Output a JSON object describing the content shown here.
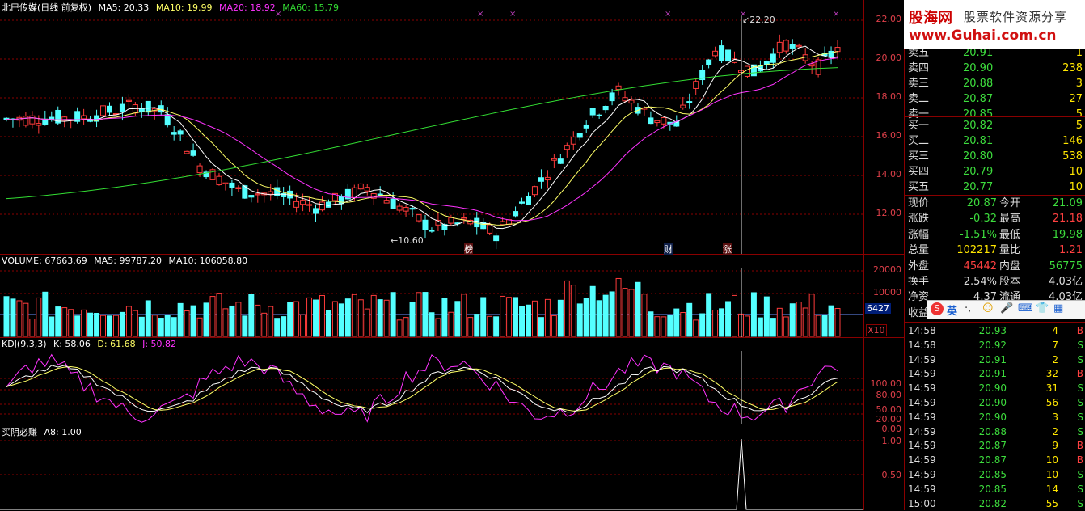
{
  "price_panel": {
    "title": "北巴传媒(日线 前复权)",
    "ma5": "MA5: 20.33",
    "ma10": "MA10: 19.99",
    "ma20": "MA20: 18.92",
    "ma60": "MA60: 15.79",
    "yticks": [
      "22.00",
      "20.00",
      "18.00",
      "16.00",
      "14.00",
      "12.00"
    ],
    "max_label": "22.20",
    "min_label": "10.60",
    "markers": [
      "榜",
      "财",
      "涨"
    ]
  },
  "volume_panel": {
    "volume": "VOLUME: 67663.69",
    "ma5": "MA5: 99787.20",
    "ma10": "MA10: 106058.80",
    "yticks": [
      "20000",
      "10000"
    ],
    "cursor_value": "6427",
    "unit": "X10"
  },
  "kdj_panel": {
    "name": "KDJ(9,3,3)",
    "k": "K: 58.06",
    "d": "D: 61.68",
    "j": "J: 50.82",
    "yticks": [
      "100.00",
      "80.00",
      "50.00",
      "20.00",
      "0.00"
    ]
  },
  "signal_panel": {
    "name": "买阴必赚",
    "a8": "A8: 1.00",
    "yticks": [
      "1.00",
      "0.50"
    ]
  },
  "banner": {
    "logo": "股海网",
    "slogan": "股票软件资源分享",
    "url": "www.Guhai.com.cn"
  },
  "order_book": {
    "asks": [
      {
        "label": "卖五",
        "price": "20.91",
        "vol": "1"
      },
      {
        "label": "卖四",
        "price": "20.90",
        "vol": "238"
      },
      {
        "label": "卖三",
        "price": "20.88",
        "vol": "3"
      },
      {
        "label": "卖二",
        "price": "20.87",
        "vol": "27"
      },
      {
        "label": "卖一",
        "price": "20.85",
        "vol": "5"
      }
    ],
    "bids": [
      {
        "label": "买一",
        "price": "20.82",
        "vol": "5"
      },
      {
        "label": "买二",
        "price": "20.81",
        "vol": "146"
      },
      {
        "label": "买三",
        "price": "20.80",
        "vol": "538"
      },
      {
        "label": "买四",
        "price": "20.79",
        "vol": "10"
      },
      {
        "label": "买五",
        "price": "20.77",
        "vol": "10"
      }
    ]
  },
  "quote": [
    {
      "l1": "现价",
      "v1": "20.87",
      "l2": "今开",
      "v2": "21.09"
    },
    {
      "l1": "涨跌",
      "v1": "-0.32",
      "l2": "最高",
      "v2": "21.18"
    },
    {
      "l1": "涨幅",
      "v1": "-1.51%",
      "l2": "最低",
      "v2": "19.98"
    },
    {
      "l1": "总量",
      "v1": "102217",
      "l2": "量比",
      "v2": "1.21"
    },
    {
      "l1": "外盘",
      "v1": "45442",
      "l2": "内盘",
      "v2": "56775"
    },
    {
      "l1": "换手",
      "v1": "2.54%",
      "l2": "股本",
      "v2": "4.03亿"
    },
    {
      "l1": "净资",
      "v1": "4.37",
      "l2": "流通",
      "v2": "4.03亿"
    },
    {
      "l1": "收益(",
      "v1": "",
      "l2": "",
      "v2": ""
    }
  ],
  "ime": {
    "label": "英"
  },
  "ticks": [
    {
      "time": "14:58",
      "price": "20.93",
      "vol": "4",
      "side": "B"
    },
    {
      "time": "14:58",
      "price": "20.92",
      "vol": "7",
      "side": "S"
    },
    {
      "time": "14:59",
      "price": "20.91",
      "vol": "2",
      "side": "S"
    },
    {
      "time": "14:59",
      "price": "20.91",
      "vol": "32",
      "side": "B"
    },
    {
      "time": "14:59",
      "price": "20.90",
      "vol": "31",
      "side": "S"
    },
    {
      "time": "14:59",
      "price": "20.90",
      "vol": "56",
      "side": "S"
    },
    {
      "time": "14:59",
      "price": "20.90",
      "vol": "3",
      "side": "S"
    },
    {
      "time": "14:59",
      "price": "20.88",
      "vol": "2",
      "side": "S"
    },
    {
      "time": "14:59",
      "price": "20.87",
      "vol": "9",
      "side": "B"
    },
    {
      "time": "14:59",
      "price": "20.87",
      "vol": "10",
      "side": "B"
    },
    {
      "time": "14:59",
      "price": "20.85",
      "vol": "10",
      "side": "S"
    },
    {
      "time": "14:59",
      "price": "20.85",
      "vol": "14",
      "side": "S"
    },
    {
      "time": "15:00",
      "price": "20.82",
      "vol": "55",
      "side": "S"
    }
  ],
  "colors": {
    "up": "#ff3b3b",
    "down": "#54ffff",
    "ma5": "#ffffff",
    "ma10": "#ffff66",
    "ma20": "#ff33ff",
    "ma60": "#33dd33",
    "grid": "#8a0000"
  },
  "chart_data": {
    "type": "candlestick",
    "panels": [
      "price",
      "volume",
      "kdj",
      "signal"
    ],
    "price_axis": {
      "ylim": [
        10.6,
        22.2
      ],
      "ticks": [
        12,
        14,
        16,
        18,
        20,
        22
      ]
    },
    "annotations": {
      "high": 22.2,
      "low": 10.6
    },
    "last": {
      "close": 20.87,
      "ma5": 20.33,
      "ma10": 19.99,
      "ma20": 18.92,
      "ma60": 15.79
    },
    "volume": {
      "last": 67663.69,
      "ma5": 99787.2,
      "ma10": 106058.8
    },
    "kdj": {
      "k": 58.06,
      "d": 61.68,
      "j": 50.82
    },
    "signal": {
      "a8": 1.0
    }
  }
}
